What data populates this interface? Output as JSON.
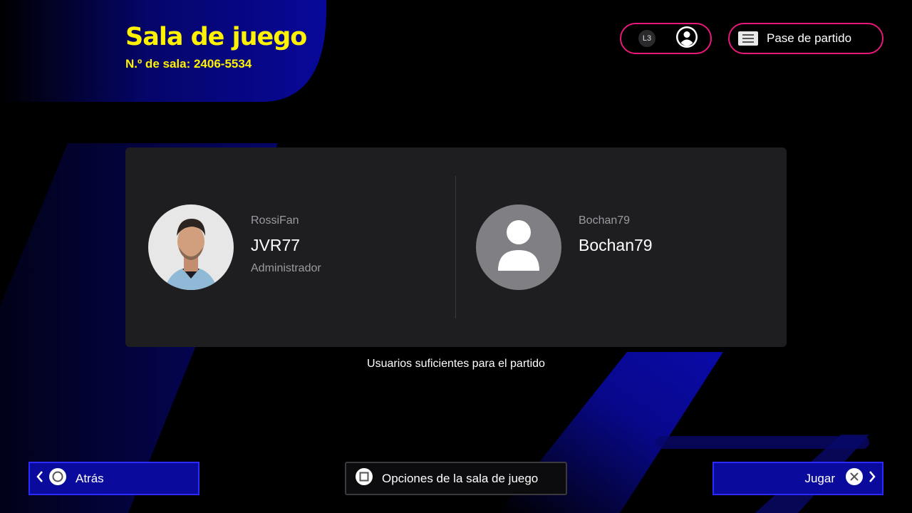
{
  "header": {
    "title": "Sala de juego",
    "room_number": "N.º de sala: 2406-5534"
  },
  "top_buttons": {
    "l3_label": "L3",
    "pass_label": "Pase de partido"
  },
  "players": [
    {
      "sub_name": "RossiFan",
      "name": "JVR77",
      "role": "Administrador"
    },
    {
      "sub_name": "Bochan79",
      "name": "Bochan79",
      "role": ""
    }
  ],
  "status": "Usuarios suficientes para el partido",
  "bottom_bar": {
    "back_label": "Atrás",
    "options_label": "Opciones de la sala de juego",
    "play_label": "Jugar"
  },
  "colors": {
    "accent_yellow": "#fff200",
    "accent_pink": "#e8187a",
    "button_blue": "#0a0a9c",
    "panel": "#1e1e21"
  },
  "icons": [
    "l3-button-icon",
    "profile-icon",
    "pass-card-icon",
    "circle-button-icon",
    "square-button-icon",
    "cross-button-icon",
    "chevron-left-icon",
    "chevron-right-icon",
    "default-avatar-icon"
  ]
}
